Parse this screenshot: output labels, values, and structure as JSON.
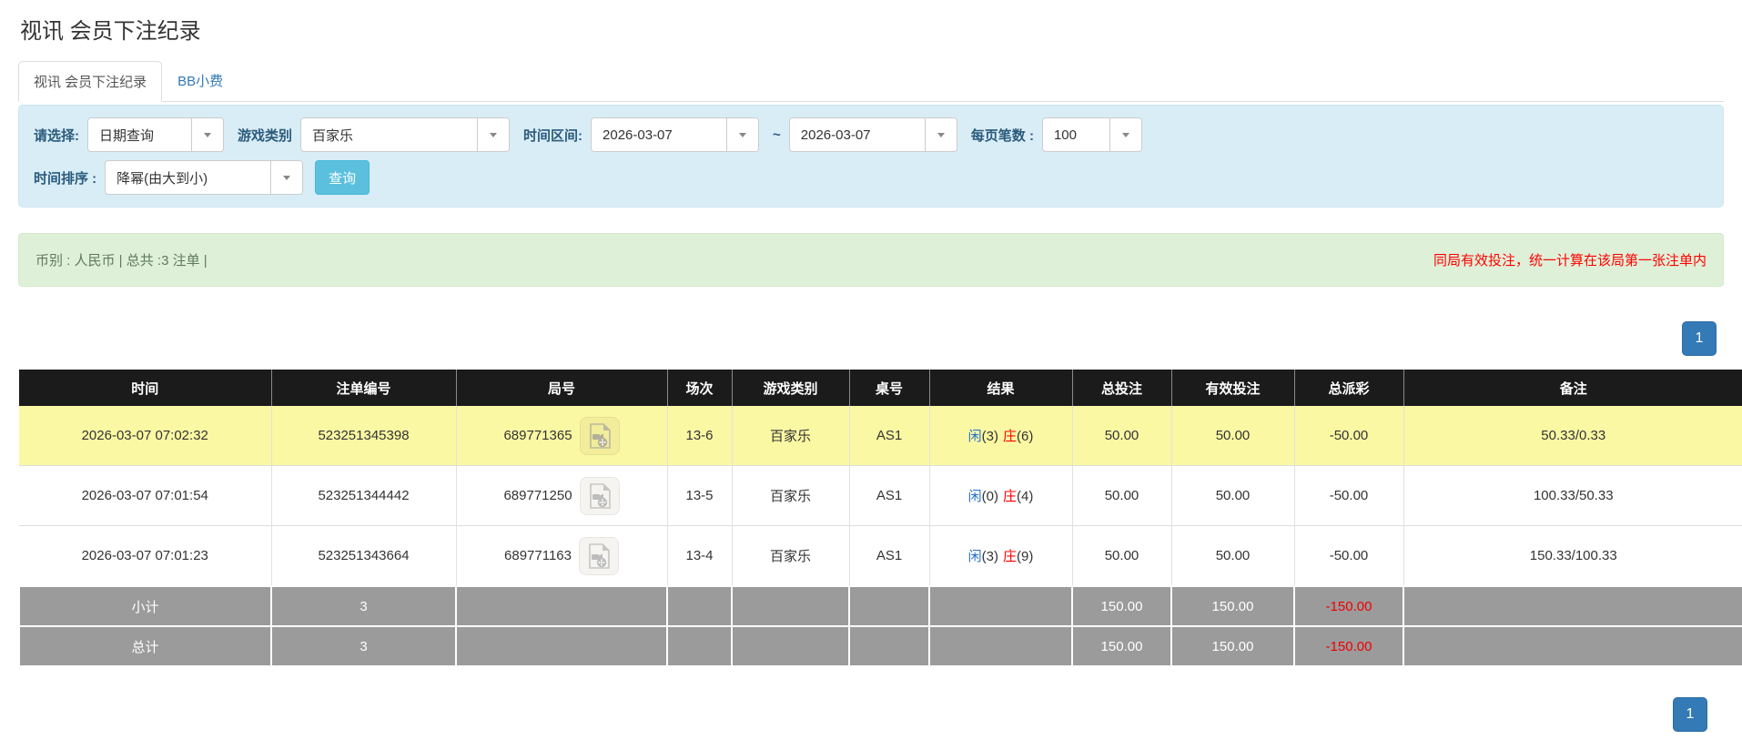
{
  "page": {
    "title": "视讯 会员下注纪录"
  },
  "tabs": [
    {
      "label": "视讯 会员下注纪录",
      "active": true
    },
    {
      "label": "BB小费",
      "active": false
    }
  ],
  "filters": {
    "select_label": "请选择:",
    "select_value": "日期查询",
    "game_type_label": "游戏类别",
    "game_type_value": "百家乐",
    "date_range_label": "时间区间:",
    "date_from": "2026-03-07",
    "tilde": "~",
    "date_to": "2026-03-07",
    "page_size_label": "每页笔数 :",
    "page_size_value": "100",
    "sort_label": "时间排序 :",
    "sort_value": "降幂(由大到小)",
    "search_button": "查询"
  },
  "summary_bar": {
    "left_text": "币别 : 人民币 | 总共 :3 注单 |",
    "right_text": "同局有效投注，统一计算在该局第一张注单内"
  },
  "pagination": {
    "page": "1"
  },
  "icons": {
    "dropdown_caret": "▼",
    "replay_video": "video-file"
  },
  "colors": {
    "accent_blue": "#337ab7",
    "panel_blue": "#d9edf7",
    "alert_green": "#dff0d8",
    "highlight_yellow": "#fbf8a3",
    "summary_gray": "#9b9b9b",
    "negative_red": "#f00000",
    "value_blue": "#2570d0"
  },
  "table": {
    "headers": [
      "时间",
      "注单编号",
      "局号",
      "场次",
      "游戏类别",
      "桌号",
      "结果",
      "总投注",
      "有效投注",
      "总派彩",
      "备注"
    ],
    "rows": [
      {
        "time": "2026-03-07 07:02:32",
        "bet_id": "523251345398",
        "round_id": "689771365",
        "session": "13-6",
        "game": "百家乐",
        "table_no": "AS1",
        "player": "闲",
        "player_score": "(3)",
        "banker": "庄",
        "banker_score": "(6)",
        "total_bet": "50.00",
        "valid_bet": "50.00",
        "payout": "-50.00",
        "remark": "50.33/0.33"
      },
      {
        "time": "2026-03-07 07:01:54",
        "bet_id": "523251344442",
        "round_id": "689771250",
        "session": "13-5",
        "game": "百家乐",
        "table_no": "AS1",
        "player": "闲",
        "player_score": "(0)",
        "banker": "庄",
        "banker_score": "(4)",
        "total_bet": "50.00",
        "valid_bet": "50.00",
        "payout": "-50.00",
        "remark": "100.33/50.33"
      },
      {
        "time": "2026-03-07 07:01:23",
        "bet_id": "523251343664",
        "round_id": "689771163",
        "session": "13-4",
        "game": "百家乐",
        "table_no": "AS1",
        "player": "闲",
        "player_score": "(3)",
        "banker": "庄",
        "banker_score": "(9)",
        "total_bet": "50.00",
        "valid_bet": "50.00",
        "payout": "-50.00",
        "remark": "150.33/100.33"
      }
    ],
    "subtotal": {
      "label": "小计",
      "count": "3",
      "total_bet": "150.00",
      "valid_bet": "150.00",
      "payout": "-150.00",
      "remark": ""
    },
    "total": {
      "label": "总计",
      "count": "3",
      "total_bet": "150.00",
      "valid_bet": "150.00",
      "payout": "-150.00",
      "remark": ""
    }
  }
}
